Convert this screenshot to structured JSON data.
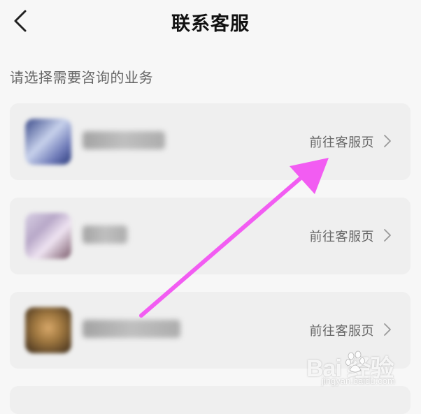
{
  "header": {
    "title": "联系客服",
    "back_icon": "chevron-left-icon"
  },
  "section": {
    "label": "请选择需要咨询的业务"
  },
  "services": [
    {
      "name_blurred": true,
      "thumb_colors": [
        "#3a4a8a",
        "#c8d2ec",
        "#6f7bb8"
      ],
      "link_label": "前往客服页",
      "link_icon": "chevron-right-icon"
    },
    {
      "name_blurred": true,
      "thumb_colors": [
        "#b8a8c8",
        "#efe4f2",
        "#7a5a6a"
      ],
      "link_label": "前往客服页",
      "link_icon": "chevron-right-icon"
    },
    {
      "name_blurred": true,
      "thumb_colors": [
        "#7a5a2a",
        "#d8a86a",
        "#3a2a1a"
      ],
      "link_label": "前往客服页",
      "link_icon": "chevron-right-icon"
    }
  ],
  "annotation": {
    "arrow_color": "#f25cf2",
    "arrow_icon": "pointer-arrow-icon"
  },
  "watermark": {
    "logo_text": "Bai  经验",
    "sub_text": "jingyan.baidu.com",
    "icon": "paw-icon"
  },
  "colors": {
    "background": "#f7f7f7",
    "card": "#efefef",
    "text_primary": "#111111",
    "text_secondary": "#666666"
  }
}
